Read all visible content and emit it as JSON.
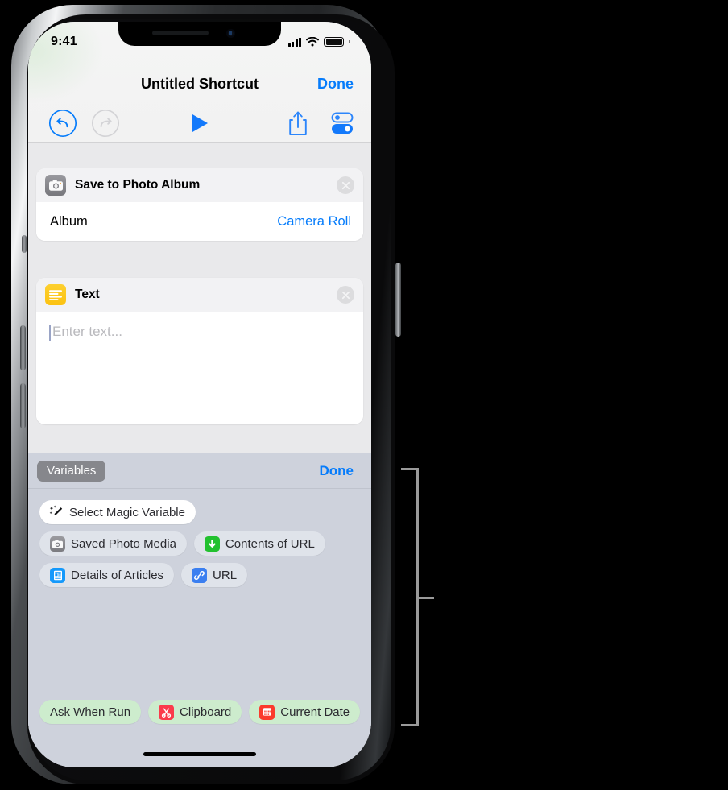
{
  "status_bar": {
    "time": "9:41",
    "cellular_icon": "signal-bars-icon",
    "wifi_icon": "wifi-icon",
    "battery_icon": "battery-full-icon"
  },
  "nav": {
    "title": "Untitled Shortcut",
    "done_label": "Done"
  },
  "toolbar": {
    "undo_icon": "undo-icon",
    "redo_icon": "redo-icon",
    "play_icon": "play-icon",
    "share_icon": "share-icon",
    "settings_icon": "settings-sliders-icon"
  },
  "actions": [
    {
      "icon": "camera-icon",
      "title": "Save to Photo Album",
      "close_icon": "close-circle-icon",
      "parameter_label": "Album",
      "parameter_value": "Camera Roll"
    },
    {
      "icon": "text-lines-icon",
      "title": "Text",
      "close_icon": "close-circle-icon",
      "placeholder": "Enter text...",
      "value": ""
    }
  ],
  "variables_panel": {
    "toggle_label": "Variables",
    "done_label": "Done",
    "magic_variable": {
      "label": "Select Magic Variable",
      "icon": "magic-wand-icon"
    },
    "magic_variables": [
      {
        "label": "Saved Photo Media",
        "icon": "camera-icon"
      },
      {
        "label": "Contents of URL",
        "icon": "download-arrow-icon"
      },
      {
        "label": "Details of Articles",
        "icon": "document-icon"
      },
      {
        "label": "URL",
        "icon": "link-icon"
      }
    ],
    "builtin_variables": [
      {
        "label": "Ask When Run",
        "icon": "none"
      },
      {
        "label": "Clipboard",
        "icon": "scissors-icon"
      },
      {
        "label": "Current Date",
        "icon": "calendar-icon"
      }
    ]
  },
  "home_indicator": "home-bar",
  "callout": {
    "bracket_icon": "callout-bracket"
  },
  "colors": {
    "accent_blue": "#067cfb",
    "panel_background": "#ced2dc",
    "list_background": "#e9e9eb",
    "chip_green": "#cdeccd",
    "chip_grayblue": "#dfe3ea",
    "variables_button": "#86878c"
  }
}
